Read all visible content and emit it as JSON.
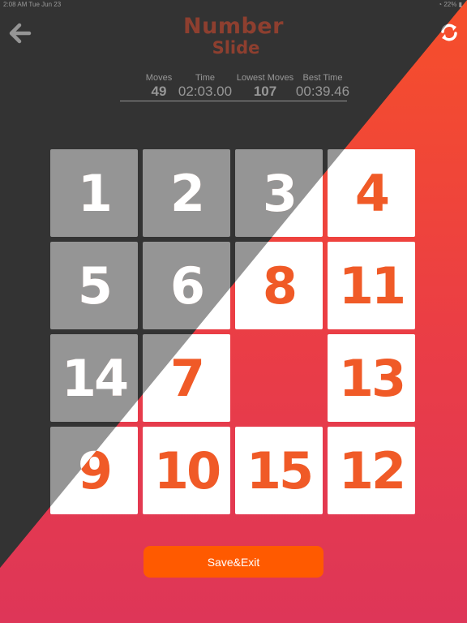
{
  "status_bar": {
    "time": "2:08 AM   Tue Jun 23",
    "battery": "22%"
  },
  "header": {
    "logo_line1": "Number",
    "logo_line2": "Slide"
  },
  "stats": {
    "moves_label": "Moves",
    "moves_value": "49",
    "time_label": "Time",
    "time_value": "02:03.00",
    "lowest_label": "Lowest Moves",
    "lowest_value": "107",
    "best_label": "Best Time",
    "best_value": "00:39.46"
  },
  "board": {
    "tiles": [
      "1",
      "2",
      "3",
      "4",
      "5",
      "6",
      "8",
      "11",
      "14",
      "7",
      "",
      "13",
      "9",
      "10",
      "15",
      "12"
    ]
  },
  "footer": {
    "save_exit_label": "Save&Exit"
  },
  "colors": {
    "accent": "#f05a27",
    "button": "#ff5a00",
    "dark_bg": "#333333"
  },
  "icons": {
    "back": "arrow-left-icon",
    "refresh": "refresh-icon"
  }
}
